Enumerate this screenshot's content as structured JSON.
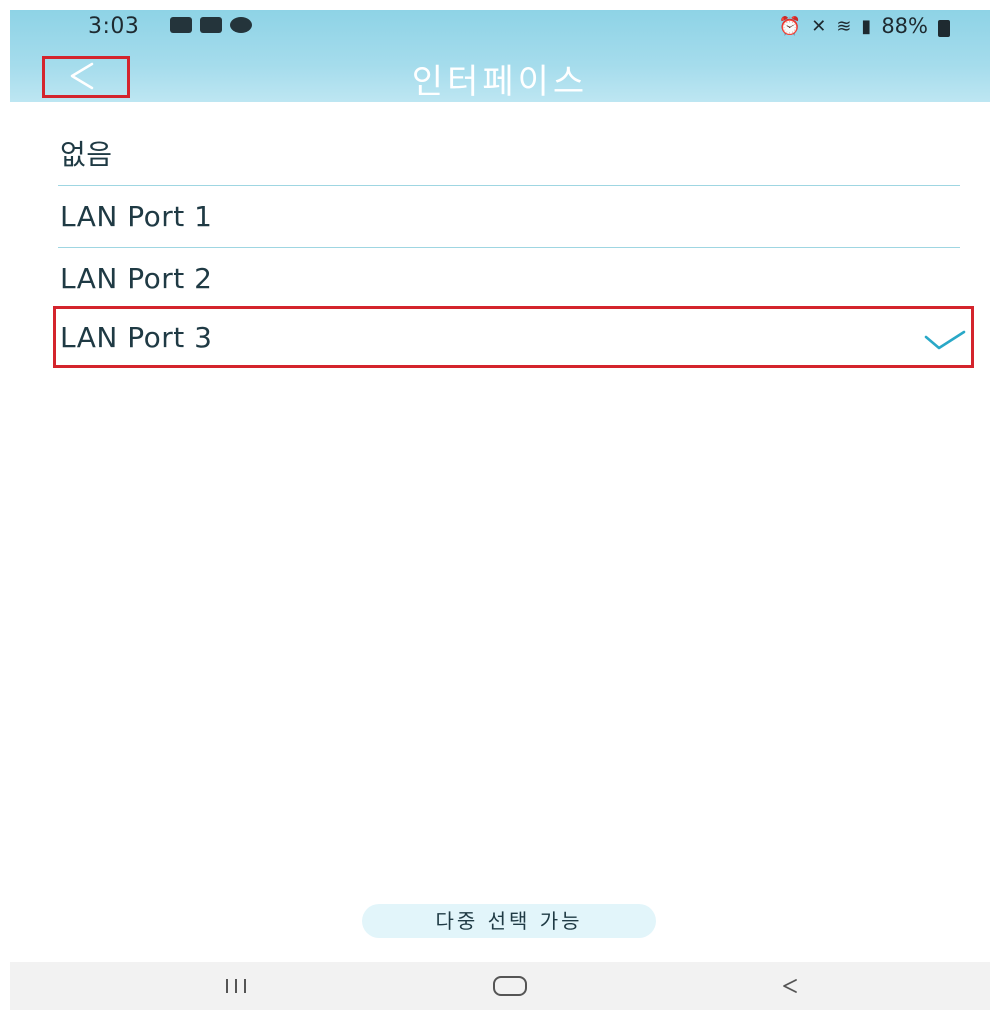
{
  "status_bar": {
    "time": "3:03",
    "battery": "88%",
    "left_icons": [
      "gallery-icon",
      "youtube-icon",
      "kakaotalk-icon"
    ],
    "right_icons": [
      "alarm-icon",
      "mute-icon",
      "wifi-icon",
      "signal-icon",
      "battery-icon"
    ]
  },
  "header": {
    "title": "인터페이스",
    "back_icon": "chevron-left-icon"
  },
  "list": {
    "items": [
      {
        "label": "없음",
        "selected": false
      },
      {
        "label": "LAN Port 1",
        "selected": false
      },
      {
        "label": "LAN Port 2",
        "selected": false
      },
      {
        "label": "LAN Port 3",
        "selected": true
      }
    ]
  },
  "footer": {
    "multi_select_label": "다중 선택 가능"
  },
  "nav_bar": {
    "buttons": [
      "recent-apps-icon",
      "home-icon",
      "back-icon"
    ]
  },
  "colors": {
    "header_gradient_top": "#8ed3e6",
    "header_gradient_bottom": "#bde6f2",
    "accent": "#29a8c7",
    "highlight_border": "#d4242c",
    "divider": "#9fd6e2"
  }
}
